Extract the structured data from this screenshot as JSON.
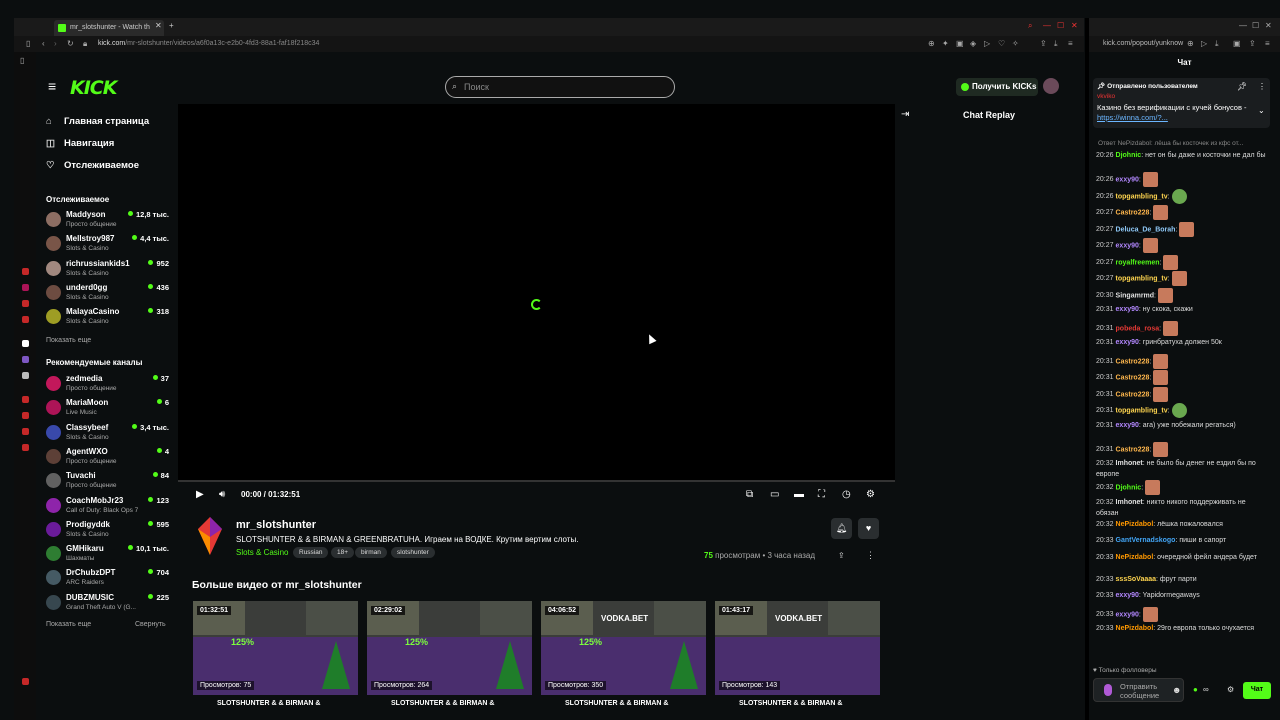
{
  "browser": {
    "tab_title": "mr_slotshunter - Watch th",
    "url_host": "kick.com",
    "url_path": "/mr-slotshunter/videos/a6f0a13c-e2b0-4fd3-88a1-faf18f218c34",
    "popup_url": "kick.com/popout/yunknow"
  },
  "header": {
    "logo": "KICK",
    "search_placeholder": "Поиск",
    "get_kicks": "Получить KICKs"
  },
  "nav": {
    "home": "Главная страница",
    "browse": "Навигация",
    "following": "Отслеживаемое"
  },
  "following": {
    "title": "Отслеживаемое",
    "channels": [
      {
        "name": "Maddyson",
        "category": "Просто общение",
        "viewers": "12,8 тыс."
      },
      {
        "name": "Mellstroy987",
        "category": "Slots & Casino",
        "viewers": "4,4 тыс."
      },
      {
        "name": "richrussiankids1",
        "category": "Slots & Casino",
        "viewers": "952"
      },
      {
        "name": "underd0gg",
        "category": "Slots & Casino",
        "viewers": "436"
      },
      {
        "name": "MalayaCasino",
        "category": "Slots & Casino",
        "viewers": "318"
      }
    ],
    "show_more": "Показать еще"
  },
  "recommended": {
    "title": "Рекомендуемые каналы",
    "channels": [
      {
        "name": "zedmedia",
        "category": "Просто общение",
        "viewers": "37"
      },
      {
        "name": "MariaMoon",
        "category": "Live Music",
        "viewers": "6"
      },
      {
        "name": "Classybeef",
        "category": "Slots & Casino",
        "viewers": "3,4 тыс."
      },
      {
        "name": "AgentWXO",
        "category": "Просто общение",
        "viewers": "4"
      },
      {
        "name": "Tuvachi",
        "category": "Просто общение",
        "viewers": "84"
      },
      {
        "name": "CoachMobJr23",
        "category": "Call of Duty: Black Ops 7",
        "viewers": "123"
      },
      {
        "name": "Prodigyddk",
        "category": "Slots & Casino",
        "viewers": "595"
      },
      {
        "name": "GMHikaru",
        "category": "Шахматы",
        "viewers": "10,1 тыс."
      },
      {
        "name": "DrChubzDPT",
        "category": "ARC Raiders",
        "viewers": "704"
      },
      {
        "name": "DUBZMUSIC",
        "category": "Grand Theft Auto V (G...",
        "viewers": "225"
      }
    ],
    "show_more": "Показать еще",
    "collapse": "Свернуть"
  },
  "player": {
    "time": "00:00 / 01:32:51",
    "progress": 0
  },
  "video": {
    "channel": "mr_slotshunter",
    "title": "SLOTSHUNTER & & BIRMAN & GREENBRATUHA. Играем на ВОДКЕ. Крутим вертим слоты.",
    "category": "Slots & Casino",
    "tags": [
      "Russian",
      "18+",
      "birman",
      "slotshunter"
    ],
    "views_count": "75",
    "views_label": "просмотрам",
    "ago": "3 часа назад"
  },
  "more_videos": {
    "title": "Больше видео от mr_slotshunter",
    "items": [
      {
        "duration": "01:32:51",
        "views": "Просмотров: 75",
        "title": "SLOTSHUNTER & & BIRMAN &",
        "brand": "",
        "offer": "125%"
      },
      {
        "duration": "02:29:02",
        "views": "Просмотров: 264",
        "title": "SLOTSHUNTER & & BIRMAN &",
        "brand": "",
        "offer": "125%"
      },
      {
        "duration": "04:06:52",
        "views": "Просмотров: 350",
        "title": "SLOTSHUNTER & & BIRMAN &",
        "brand": "VODKA.BET",
        "offer": "125%"
      },
      {
        "duration": "01:43:17",
        "views": "Просмотров: 143",
        "title": "SLOTSHUNTER & & BIRMAN &",
        "brand": "VODKA.BET",
        "offer": ""
      }
    ]
  },
  "chat_replay": {
    "title": "Chat Replay"
  },
  "chat": {
    "title": "Чат",
    "pinned_by": "Отправлено пользователем",
    "pinned_user": "vkviko",
    "pinned_text": "Казино без верификации с кучей бонусов - ",
    "pinned_link": "https://winna.com/?...",
    "reply_hint": "Ответ NePizdabol: лёша бы косточек из кфс от...",
    "messages": [
      {
        "ts": "20:26",
        "user": "Djohnic",
        "color": "#53fc18",
        "text": "нет он бы даже и косточки не дал бы",
        "emote": ""
      },
      {
        "ts": "20:26",
        "user": "exxy90",
        "color": "#b388ff",
        "text": "",
        "emote": "face"
      },
      {
        "ts": "20:26",
        "user": "topgambling_tv",
        "color": "#ffd54f",
        "text": "",
        "emote": "frog"
      },
      {
        "ts": "20:27",
        "user": "Castro228",
        "color": "#ffb74d",
        "text": "",
        "emote": "face"
      },
      {
        "ts": "20:27",
        "user": "Deluca_De_Borah",
        "color": "#90caf9",
        "text": "",
        "emote": "face"
      },
      {
        "ts": "20:27",
        "user": "exxy90",
        "color": "#b388ff",
        "text": "",
        "emote": "face"
      },
      {
        "ts": "20:27",
        "user": "royalfreemen",
        "color": "#53fc18",
        "text": "",
        "emote": "face"
      },
      {
        "ts": "20:27",
        "user": "topgambling_tv",
        "color": "#ffd54f",
        "text": "",
        "emote": "face"
      },
      {
        "ts": "20:30",
        "user": "Singamrmd",
        "color": "#e0e0e0",
        "text": "",
        "emote": "face"
      },
      {
        "ts": "20:31",
        "user": "exxy90",
        "color": "#b388ff",
        "text": "ну скока, скажи",
        "emote": ""
      },
      {
        "ts": "20:31",
        "user": "pobeda_rosa",
        "color": "#e53935",
        "text": "",
        "emote": "face"
      },
      {
        "ts": "20:31",
        "user": "exxy90",
        "color": "#b388ff",
        "text": "гринбратуха должен 50к",
        "emote": ""
      },
      {
        "ts": "20:31",
        "user": "Castro228",
        "color": "#ffb74d",
        "text": "",
        "emote": "face"
      },
      {
        "ts": "20:31",
        "user": "Castro228",
        "color": "#ffb74d",
        "text": "",
        "emote": "face"
      },
      {
        "ts": "20:31",
        "user": "Castro228",
        "color": "#ffb74d",
        "text": "",
        "emote": "face"
      },
      {
        "ts": "20:31",
        "user": "topgambling_tv",
        "color": "#ffd54f",
        "text": "",
        "emote": "frog"
      },
      {
        "ts": "20:31",
        "user": "exxy90",
        "color": "#b388ff",
        "text": "ага) уже побежали регаться)",
        "emote": ""
      },
      {
        "ts": "20:31",
        "user": "Castro228",
        "color": "#ffb74d",
        "text": "",
        "emote": "face"
      },
      {
        "ts": "20:32",
        "user": "Imhonet",
        "color": "#e0e0e0",
        "text": "не было бы денег не ездил бы по европе",
        "emote": ""
      },
      {
        "ts": "20:32",
        "user": "Djohnic",
        "color": "#53fc18",
        "text": "",
        "emote": "face"
      },
      {
        "ts": "20:32",
        "user": "Imhonet",
        "color": "#e0e0e0",
        "text": "никто никого поддерживать не обязан",
        "emote": ""
      },
      {
        "ts": "20:32",
        "user": "NePizdabol",
        "color": "#ff9800",
        "text": "лёшка пожаловался",
        "emote": ""
      },
      {
        "ts": "20:33",
        "user": "GantVernadskogo",
        "color": "#42a5f5",
        "text": "пиши в сапорт",
        "emote": ""
      },
      {
        "ts": "20:33",
        "user": "NePizdabol",
        "color": "#ff9800",
        "text": "очередной фейл андера будет",
        "emote": ""
      },
      {
        "ts": "20:33",
        "user": "sssSoVaaaa",
        "color": "#ffd54f",
        "text": "фрут парти",
        "emote": ""
      },
      {
        "ts": "20:33",
        "user": "exxy90",
        "color": "#b388ff",
        "text": "Yapidormegaways",
        "emote": ""
      },
      {
        "ts": "20:33",
        "user": "exxy90",
        "color": "#b388ff",
        "text": "",
        "emote": "face"
      },
      {
        "ts": "20:33",
        "user": "NePizdabol",
        "color": "#ff9800",
        "text": "29го европа только очухается",
        "emote": ""
      }
    ],
    "only_followers": "Только фолловеры",
    "input_placeholder": "Отправить сообщение",
    "send": "Чат"
  }
}
